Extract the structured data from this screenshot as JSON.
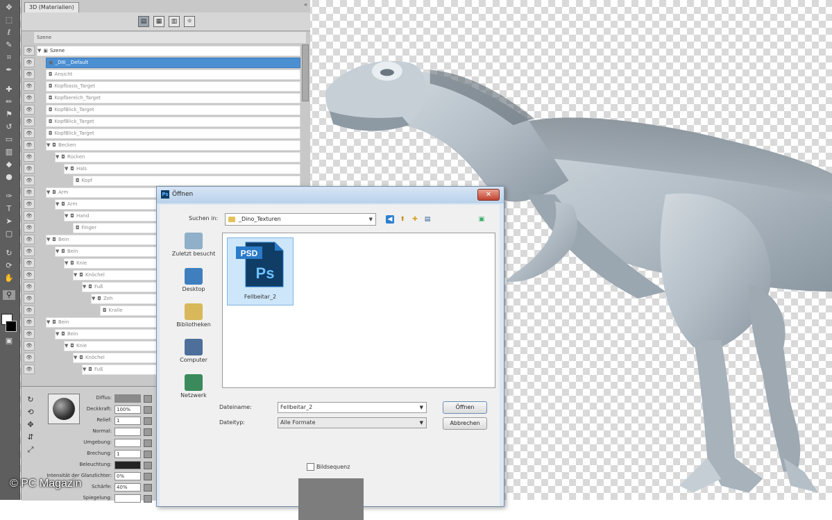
{
  "panel": {
    "tab_label": "3D (Materialien)",
    "column_header": "Szene",
    "collapse_glyph": "«",
    "tree": [
      {
        "label": "Szene",
        "depth": 0,
        "twisty": "▼",
        "icon": "▣",
        "state": "dark"
      },
      {
        "label": "_DIII__Default",
        "depth": 1,
        "twisty": "",
        "icon": "▣",
        "state": "selected"
      },
      {
        "label": "Ansicht",
        "depth": 1,
        "twisty": "",
        "icon": "◘",
        "state": "normal"
      },
      {
        "label": "Kopfbasis_Target",
        "depth": 1,
        "twisty": "",
        "icon": "◘",
        "state": "normal"
      },
      {
        "label": "Kopfbereich_Target",
        "depth": 1,
        "twisty": "",
        "icon": "◘",
        "state": "normal"
      },
      {
        "label": "KopfBlick_Target",
        "depth": 1,
        "twisty": "",
        "icon": "◘",
        "state": "normal"
      },
      {
        "label": "KopfBlick_Target",
        "depth": 1,
        "twisty": "",
        "icon": "◘",
        "state": "normal"
      },
      {
        "label": "KopfBlick_Target",
        "depth": 1,
        "twisty": "",
        "icon": "◘",
        "state": "normal"
      },
      {
        "label": "Becken",
        "depth": 1,
        "twisty": "▼",
        "icon": "◘",
        "state": "normal"
      },
      {
        "label": "Rücken",
        "depth": 2,
        "twisty": "▼",
        "icon": "◘",
        "state": "normal"
      },
      {
        "label": "Hals",
        "depth": 3,
        "twisty": "▼",
        "icon": "◘",
        "state": "normal"
      },
      {
        "label": "Kopf",
        "depth": 4,
        "twisty": "",
        "icon": "◘",
        "state": "normal"
      },
      {
        "label": "Arm",
        "depth": 1,
        "twisty": "▼",
        "icon": "◘",
        "state": "normal"
      },
      {
        "label": "Arm",
        "depth": 2,
        "twisty": "▼",
        "icon": "◘",
        "state": "normal"
      },
      {
        "label": "Hand",
        "depth": 3,
        "twisty": "▼",
        "icon": "◘",
        "state": "normal"
      },
      {
        "label": "Finger",
        "depth": 4,
        "twisty": "",
        "icon": "◘",
        "state": "normal"
      },
      {
        "label": "Bein",
        "depth": 1,
        "twisty": "▼",
        "icon": "◘",
        "state": "normal"
      },
      {
        "label": "Bein",
        "depth": 2,
        "twisty": "▼",
        "icon": "◘",
        "state": "normal"
      },
      {
        "label": "Knie",
        "depth": 3,
        "twisty": "▼",
        "icon": "◘",
        "state": "normal"
      },
      {
        "label": "Knöchel",
        "depth": 4,
        "twisty": "▼",
        "icon": "◘",
        "state": "normal"
      },
      {
        "label": "Fuß",
        "depth": 5,
        "twisty": "▼",
        "icon": "◘",
        "state": "normal"
      },
      {
        "label": "Zeh",
        "depth": 6,
        "twisty": "▼",
        "icon": "◘",
        "state": "normal"
      },
      {
        "label": "Kralle",
        "depth": 7,
        "twisty": "",
        "icon": "◘",
        "state": "normal"
      },
      {
        "label": "Bein",
        "depth": 1,
        "twisty": "▼",
        "icon": "◘",
        "state": "normal"
      },
      {
        "label": "Bein",
        "depth": 2,
        "twisty": "▼",
        "icon": "◘",
        "state": "normal"
      },
      {
        "label": "Knie",
        "depth": 3,
        "twisty": "▼",
        "icon": "◘",
        "state": "normal"
      },
      {
        "label": "Knöchel",
        "depth": 4,
        "twisty": "▼",
        "icon": "◘",
        "state": "normal"
      },
      {
        "label": "Fuß",
        "depth": 5,
        "twisty": "▼",
        "icon": "◘",
        "state": "normal"
      }
    ],
    "props": {
      "rows": [
        {
          "label": "Diffus:",
          "value": ""
        },
        {
          "label": "Deckkraft:",
          "value": "100%"
        },
        {
          "label": "Relief:",
          "value": "1"
        },
        {
          "label": "Normal:",
          "value": ""
        },
        {
          "label": "Umgebung:",
          "value": ""
        },
        {
          "label": "Brechung:",
          "value": "1"
        },
        {
          "label": "Beleuchtung:",
          "value": ""
        },
        {
          "label": "Intensität der Glanzlichter:",
          "value": "0%"
        },
        {
          "label": "Schärfe:",
          "value": "40%"
        },
        {
          "label": "Spiegelung:",
          "value": ""
        }
      ]
    }
  },
  "dialog": {
    "title": "Öffnen",
    "lookin_label": "Suchen in:",
    "lookin_value": "_Dino_Texturen",
    "places": [
      "Zuletzt besucht",
      "Desktop",
      "Bibliotheken",
      "Computer",
      "Netzwerk"
    ],
    "file": {
      "badge": "PSD",
      "logo": "Ps",
      "name": "Fellbeitar_2"
    },
    "filename_label": "Dateiname:",
    "filename_value": "Fellbeitar_2",
    "filetype_label": "Dateityp:",
    "filetype_value": "Alle Formate",
    "open_button": "Öffnen",
    "cancel_button": "Abbrechen",
    "sequence_label": "Bildsequenz",
    "close_glyph": "✕",
    "ps_glyph": "Ps"
  },
  "watermark": "© PC Magazin",
  "colors": {
    "selection": "#4b8fd3",
    "dino_skin": "#b9c4cc",
    "ps_blue": "#0f3d66"
  }
}
